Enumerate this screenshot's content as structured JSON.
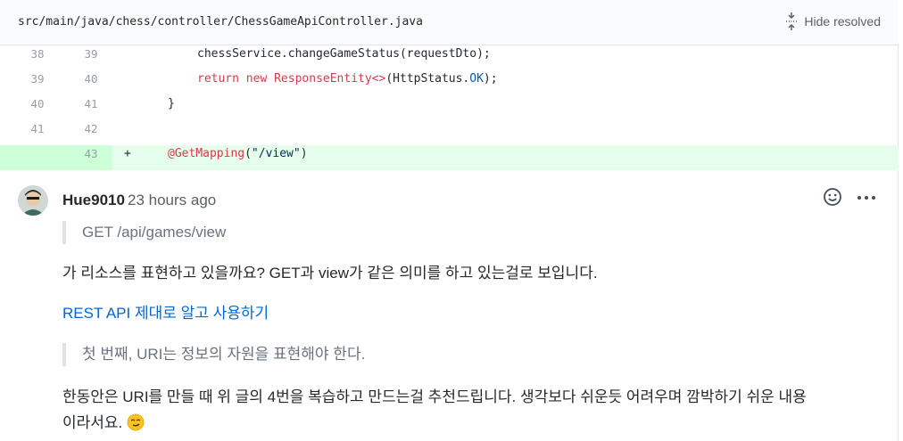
{
  "file": {
    "path": "src/main/java/chess/controller/ChessGameApiController.java",
    "hide_resolved_label": "Hide resolved"
  },
  "diff": {
    "rows": [
      {
        "old": "38",
        "new": "39",
        "type": "context"
      },
      {
        "old": "39",
        "new": "40",
        "type": "context"
      },
      {
        "old": "40",
        "new": "41",
        "type": "context"
      },
      {
        "old": "41",
        "new": "42",
        "type": "context"
      },
      {
        "old": "",
        "new": "43",
        "type": "added",
        "marker": "+"
      }
    ],
    "code": {
      "line1": "chessService.changeGameStatus(requestDto);",
      "line2_kw1": "return",
      "line2_kw2": "new",
      "line2_class": "ResponseEntity<>",
      "line2_mid": "(HttpStatus.",
      "line2_const": "OK",
      "line2_end": ");",
      "line3": "}",
      "line4": "",
      "line5_ann": "@GetMapping",
      "line5_open": "(",
      "line5_str": "\"/view\"",
      "line5_close": ")"
    }
  },
  "comment": {
    "author": "Hue9010",
    "time": "23 hours ago",
    "quote1": "GET /api/games/view",
    "para1": "가 리소스를 표현하고 있을까요? GET과 view가 같은 의미를 하고 있는걸로 보입니다.",
    "link_text": "REST API 제대로 알고 사용하기",
    "quote2": "첫 번째, URI는 정보의 자원을 표현해야 한다.",
    "para3_line1": "한동안은 URI를 만들 때 위 글의 4번을 복습하고 만드는걸 추천드립니다. 생각보다 쉬운듯 어려우며 깜박하기 쉬운 내용",
    "para3_line2": "이라서요.",
    "icons": {
      "avatar": "user-avatar",
      "reaction": "smiley-icon",
      "more": "kebab-horizontal-icon",
      "hide": "fold-icon",
      "emoji": "smirk-emoji"
    }
  }
}
